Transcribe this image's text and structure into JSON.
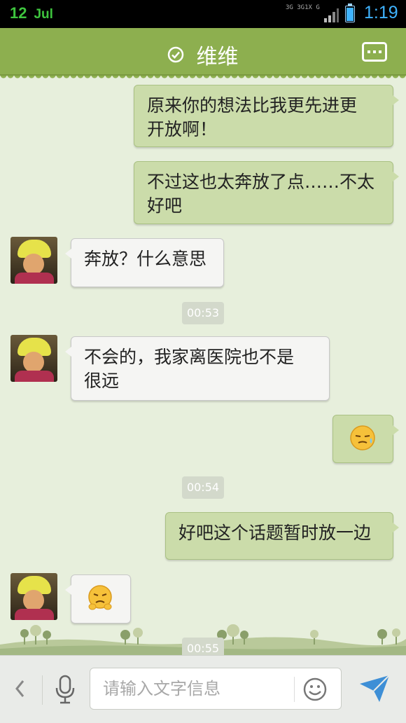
{
  "status_bar": {
    "day": "12",
    "month": "Jul",
    "network_top": "3G 3G1X G",
    "time": "1:19"
  },
  "header": {
    "title": "维维",
    "status_icon": "check-circle-icon",
    "menu_icon": "more-dots-icon"
  },
  "messages": [
    {
      "side": "out",
      "text_lines": [
        "原来你的想法比我更先进更",
        "开放啊！"
      ]
    },
    {
      "side": "out",
      "text_lines": [
        "不过这也太奔放了点……不太",
        "好吧"
      ]
    },
    {
      "side": "in",
      "text_lines": [
        "奔放？什么意思"
      ]
    },
    {
      "time": "00:53"
    },
    {
      "side": "in",
      "text_lines": [
        "不会的，我家离医院也不是",
        "很远"
      ]
    },
    {
      "side": "out",
      "emoji": "sweat-emoji-icon"
    },
    {
      "time": "00:54"
    },
    {
      "side": "out",
      "text_lines": [
        "好吧这个话题暂时放一边"
      ]
    },
    {
      "side": "in",
      "emoji": "grumpy-emoji-icon"
    },
    {
      "time": "00:55"
    }
  ],
  "input_bar": {
    "placeholder": "请输入文字信息",
    "value": ""
  },
  "colors": {
    "header": "#8daf4f",
    "background": "#e7efdc",
    "outgoing_bubble": "#cbdcaa",
    "incoming_bubble": "#f5f5f3",
    "accent": "#3fb3ff"
  }
}
